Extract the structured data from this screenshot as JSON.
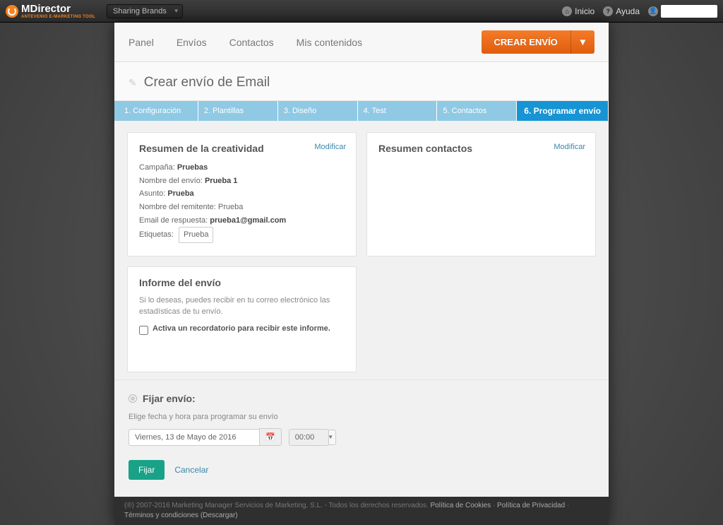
{
  "topbar": {
    "logo_text": "MDirector",
    "logo_sub": "ANTEVENIO E-MARKETING TOOL",
    "brand_selected": "Sharing Brands",
    "inicio": "Inicio",
    "ayuda": "Ayuda"
  },
  "nav": {
    "panel": "Panel",
    "envios": "Envíos",
    "contactos": "Contactos",
    "mis_contenidos": "Mis contenidos",
    "crear_envio": "CREAR ENVÍO"
  },
  "page_title": "Crear envío de Email",
  "wizard": {
    "s1": "1. Configuración",
    "s2": "2. Plantillas",
    "s3": "3. Diseño",
    "s4": "4. Test",
    "s5": "5. Contactos",
    "s6": "6. Programar envío"
  },
  "summary": {
    "title": "Resumen de la creatividad",
    "modify": "Modificar",
    "campaign_label": "Campaña:",
    "campaign_value": "Pruebas",
    "name_label": "Nombre del envío:",
    "name_value": "Prueba 1",
    "subject_label": "Asunto:",
    "subject_value": "Prueba",
    "sender_label": "Nombre del remitente:",
    "sender_value": "Prueba",
    "reply_label": "Email de respuesta:",
    "reply_value": "prueba1@gmail.com",
    "tags_label": "Etiquetas:",
    "tag_value": "Prueba"
  },
  "contacts": {
    "title": "Resumen contactos",
    "modify": "Modificar"
  },
  "report": {
    "title": "Informe del envío",
    "desc": "Si lo deseas, puedes recibir en tu correo electrónico las estadísticas de tu envío.",
    "chk_label": "Activa un recordatorio para recibir este informe."
  },
  "schedule": {
    "title": "Fijar envío:",
    "sub": "Elige fecha y hora para programar su envío",
    "date_value": "Viernes, 13 de Mayo de 2016",
    "time_value": "00:00",
    "submit": "Fijar",
    "cancel": "Cancelar"
  },
  "footer": {
    "copyright": "(®) 2007-2016 Marketing Manager Servicios de Marketing, S.L. - Todos los derechos reservados.",
    "cookies": "Política de Cookies",
    "privacy": "Política de Privacidad",
    "terms": "Términos y condiciones (Descargar)",
    "sep": " · "
  }
}
